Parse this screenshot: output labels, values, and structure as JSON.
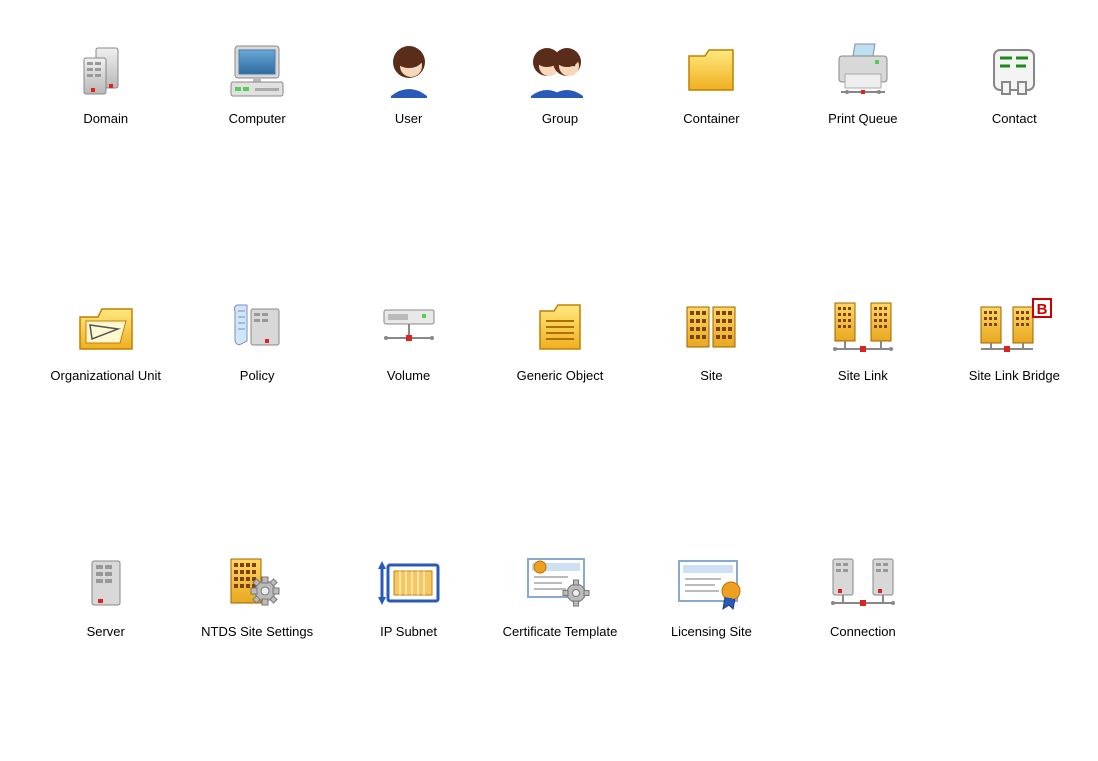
{
  "icons": [
    {
      "name": "domain",
      "label": "Domain"
    },
    {
      "name": "computer",
      "label": "Computer"
    },
    {
      "name": "user",
      "label": "User"
    },
    {
      "name": "group",
      "label": "Group"
    },
    {
      "name": "container",
      "label": "Container"
    },
    {
      "name": "print-queue",
      "label": "Print Queue"
    },
    {
      "name": "contact",
      "label": "Contact"
    },
    {
      "name": "organizational-unit",
      "label": "Organizational Unit"
    },
    {
      "name": "policy",
      "label": "Policy"
    },
    {
      "name": "volume",
      "label": "Volume"
    },
    {
      "name": "generic-object",
      "label": "Generic Object"
    },
    {
      "name": "site",
      "label": "Site"
    },
    {
      "name": "site-link",
      "label": "Site Link"
    },
    {
      "name": "site-link-bridge",
      "label": "Site Link Bridge"
    },
    {
      "name": "server",
      "label": "Server"
    },
    {
      "name": "ntds-site-settings",
      "label": "NTDS Site Settings"
    },
    {
      "name": "ip-subnet",
      "label": "IP Subnet"
    },
    {
      "name": "certificate-template",
      "label": "Certificate Template"
    },
    {
      "name": "licensing-site",
      "label": "Licensing Site"
    },
    {
      "name": "connection",
      "label": "Connection"
    }
  ]
}
